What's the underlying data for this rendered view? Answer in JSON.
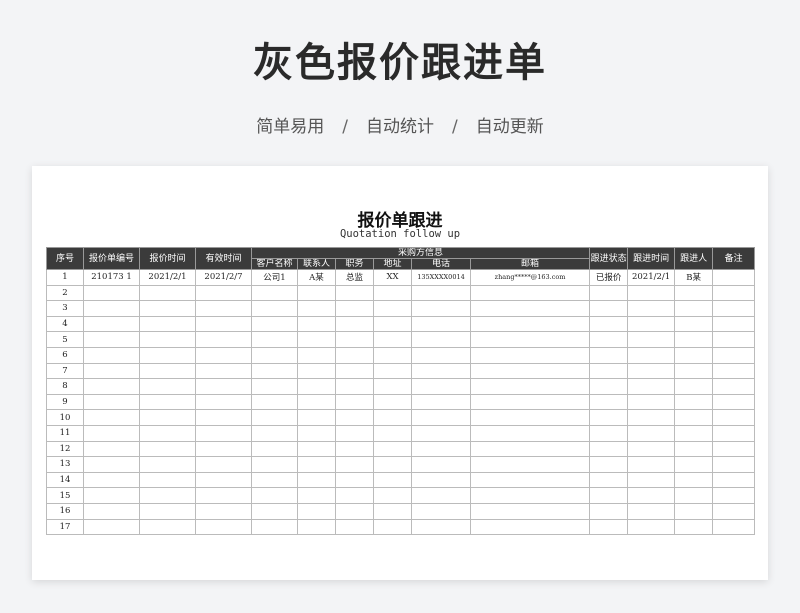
{
  "banner": {
    "title": "灰色报价跟进单",
    "features": [
      "简单易用",
      "自动统计",
      "自动更新"
    ],
    "separator": "/"
  },
  "document": {
    "title": "报价单跟进",
    "subtitle": "Quotation follow up"
  },
  "table": {
    "headers": {
      "seq": "序号",
      "quote_no": "报价单编号",
      "quote_time": "报价时间",
      "valid_time": "有效时间",
      "purchaser_group": "采购方信息",
      "customer": "客户名称",
      "contact": "联系人",
      "position": "职务",
      "address": "地址",
      "phone": "电话",
      "email": "邮箱",
      "status": "跟进状态",
      "follow_time": "跟进时间",
      "follower": "跟进人",
      "note": "备注"
    },
    "rows": [
      {
        "seq": "1",
        "quote_no": "210173 1",
        "quote_time": "2021/2/1",
        "valid_time": "2021/2/7",
        "customer": "公司1",
        "contact": "A某",
        "position": "总监",
        "address": "XX",
        "phone": "135XXXX0014",
        "email": "zhang*****@163.com",
        "status": "已报价",
        "follow_time": "2021/2/1",
        "follower": "B某",
        "note": ""
      },
      {
        "seq": "2"
      },
      {
        "seq": "3"
      },
      {
        "seq": "4"
      },
      {
        "seq": "5"
      },
      {
        "seq": "6"
      },
      {
        "seq": "7"
      },
      {
        "seq": "8"
      },
      {
        "seq": "9"
      },
      {
        "seq": "10"
      },
      {
        "seq": "11"
      },
      {
        "seq": "12"
      },
      {
        "seq": "13"
      },
      {
        "seq": "14"
      },
      {
        "seq": "15"
      },
      {
        "seq": "16"
      },
      {
        "seq": "17"
      }
    ]
  }
}
